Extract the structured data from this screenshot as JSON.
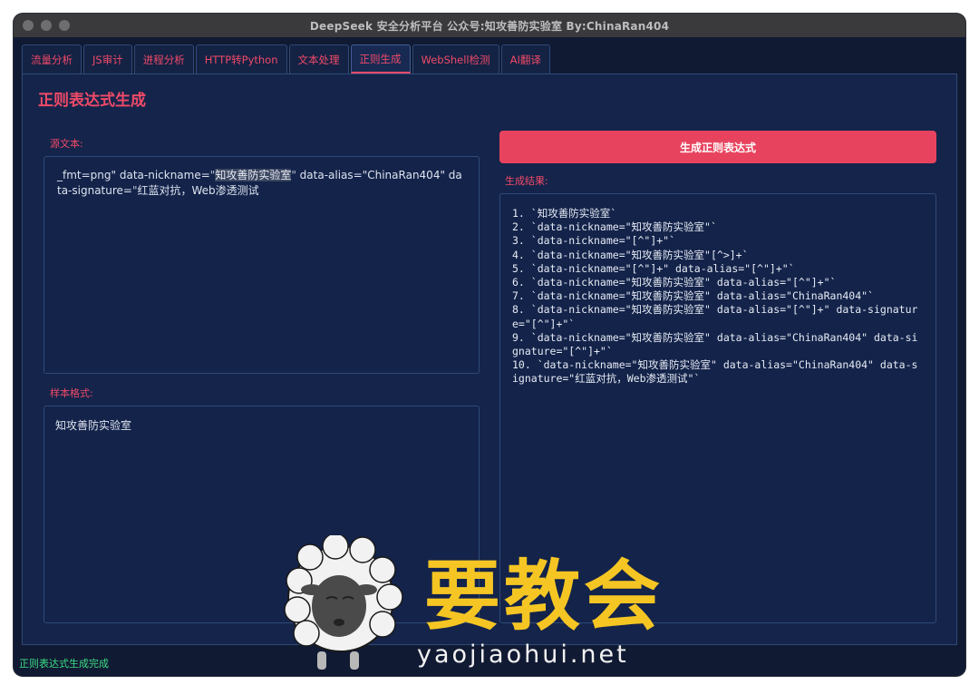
{
  "window": {
    "title": "DeepSeek 安全分析平台 公众号:知攻善防实验室 By:ChinaRan404"
  },
  "tabs": [
    {
      "label": "流量分析",
      "active": false
    },
    {
      "label": "JS审计",
      "active": false
    },
    {
      "label": "进程分析",
      "active": false
    },
    {
      "label": "HTTP转Python",
      "active": false
    },
    {
      "label": "文本处理",
      "active": false
    },
    {
      "label": "正则生成",
      "active": true
    },
    {
      "label": "WebShell检测",
      "active": false
    },
    {
      "label": "AI翻译",
      "active": false
    }
  ],
  "page": {
    "title": "正则表达式生成",
    "source_label": "源文本:",
    "source_parts": [
      "_fmt=png\" data-nickname=",
      "\"",
      "知攻善防实验室",
      "\"",
      " data-alias=",
      "\"ChinaRan404\"",
      " data-signature=",
      "\"",
      "红蓝对抗，Web渗透测试"
    ],
    "sample_label": "样本格式:",
    "sample_value": "知攻善防实验室",
    "generate_button": "生成正则表达式",
    "result_label": "生成结果:",
    "results": [
      "1. `知攻善防实验室`",
      "2. `data-nickname=\"知攻善防实验室\"`",
      "3. `data-nickname=\"[^\"]+\"`",
      "4. `data-nickname=\"知攻善防实验室\"[^>]+`",
      "5. `data-nickname=\"[^\"]+\" data-alias=\"[^\"]+\"`",
      "6. `data-nickname=\"知攻善防实验室\" data-alias=\"[^\"]+\"`",
      "7. `data-nickname=\"知攻善防实验室\" data-alias=\"ChinaRan404\"`",
      "8. `data-nickname=\"知攻善防实验室\" data-alias=\"[^\"]+\" data-signature=\"[^\"]+\"`",
      "9. `data-nickname=\"知攻善防实验室\" data-alias=\"ChinaRan404\" data-signature=\"[^\"]+\"`",
      "10. `data-nickname=\"知攻善防实验室\" data-alias=\"ChinaRan404\" data-signature=\"红蓝对抗，Web渗透测试\"`"
    ]
  },
  "status": "正则表达式生成完成",
  "watermark": {
    "text": "要教会",
    "url": "yaojiaohui.net"
  },
  "colors": {
    "accent": "#f04a68",
    "button": "#e8435e",
    "status": "#3ddc84",
    "background": "#15244a",
    "watermark": "#f5c623"
  }
}
